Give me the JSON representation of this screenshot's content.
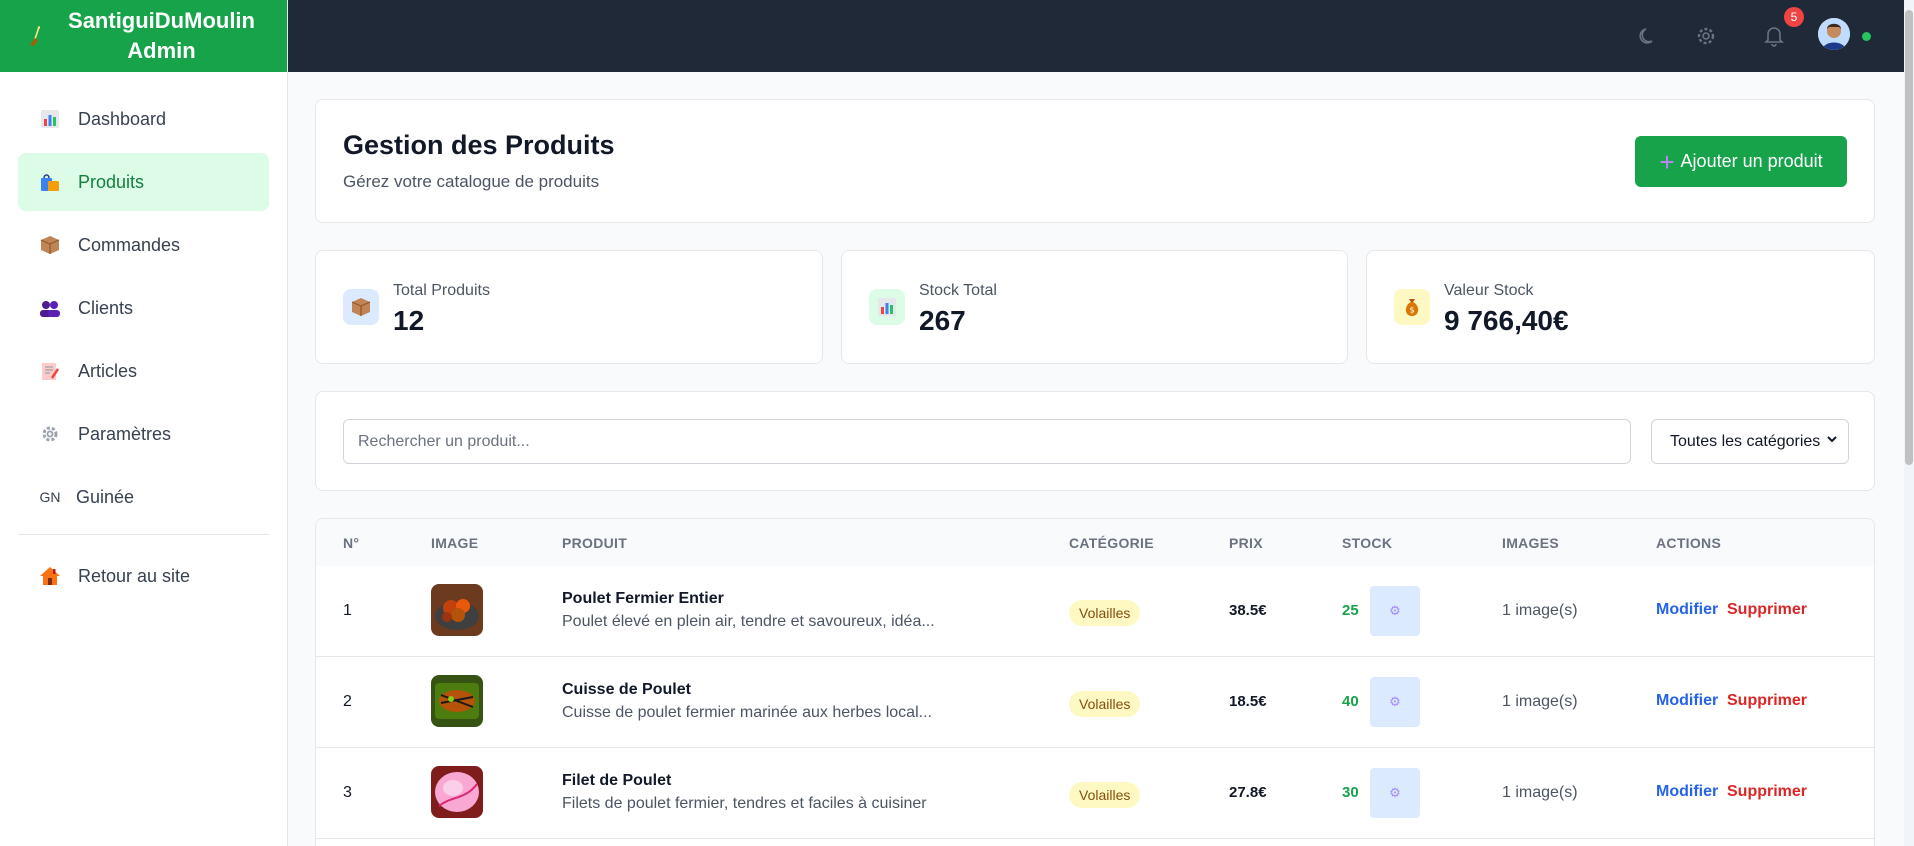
{
  "brand": {
    "title_line1": "SantiguiDuMoulin",
    "title_line2": "Admin"
  },
  "sidebar": {
    "items": [
      {
        "label": "Dashboard",
        "icon": "bar-chart-icon"
      },
      {
        "label": "Produits",
        "icon": "shopping-bags-icon"
      },
      {
        "label": "Commandes",
        "icon": "package-icon"
      },
      {
        "label": "Clients",
        "icon": "users-icon"
      },
      {
        "label": "Articles",
        "icon": "memo-icon"
      },
      {
        "label": "Paramètres",
        "icon": "gear-icon"
      },
      {
        "label": "Guinée",
        "icon": "GN"
      }
    ],
    "back": {
      "label": "Retour au site",
      "icon": "house-icon"
    }
  },
  "topbar": {
    "notifications_count": "5"
  },
  "header": {
    "title": "Gestion des Produits",
    "subtitle": "Gérez votre catalogue de produits",
    "add_button": "Ajouter un produit"
  },
  "stats": [
    {
      "label": "Total Produits",
      "value": "12"
    },
    {
      "label": "Stock Total",
      "value": "267"
    },
    {
      "label": "Valeur Stock",
      "value": "9 766,40€"
    }
  ],
  "filters": {
    "search_placeholder": "Rechercher un produit...",
    "category_selected": "Toutes les catégories"
  },
  "table": {
    "columns": [
      "N°",
      "IMAGE",
      "PRODUIT",
      "CATÉGORIE",
      "PRIX",
      "STOCK",
      "IMAGES",
      "ACTIONS"
    ],
    "rows": [
      {
        "num": "1",
        "name": "Poulet Fermier Entier",
        "desc": "Poulet élevé en plein air, tendre et savoureux, idéa...",
        "category": "Volailles",
        "price": "38.5€",
        "stock": "25",
        "images": "1 image(s)",
        "edit": "Modifier",
        "delete": "Supprimer"
      },
      {
        "num": "2",
        "name": "Cuisse de Poulet",
        "desc": "Cuisse de poulet fermier marinée aux herbes local...",
        "category": "Volailles",
        "price": "18.5€",
        "stock": "40",
        "images": "1 image(s)",
        "edit": "Modifier",
        "delete": "Supprimer"
      },
      {
        "num": "3",
        "name": "Filet de Poulet",
        "desc": "Filets de poulet fermier, tendres et faciles à cuisiner",
        "category": "Volailles",
        "price": "27.8€",
        "stock": "30",
        "images": "1 image(s)",
        "edit": "Modifier",
        "delete": "Supprimer"
      }
    ]
  },
  "colors": {
    "brand_green": "#16a34a",
    "topbar": "#1f2937",
    "active_bg": "#dcfce7"
  }
}
